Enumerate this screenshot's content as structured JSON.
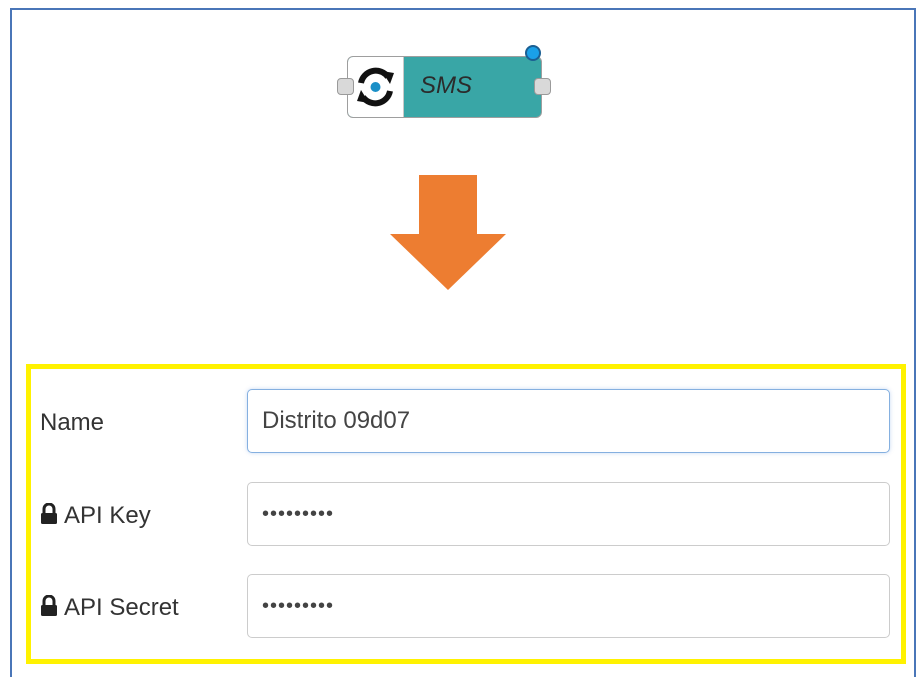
{
  "node": {
    "label": "SMS",
    "icon": "sync-icon",
    "colors": {
      "body": "#39a6a6",
      "status": "#1aa0e8"
    }
  },
  "arrow": {
    "color": "#ed7d31"
  },
  "highlight": {
    "color": "#fff200"
  },
  "form": {
    "name": {
      "label": "Name",
      "value": "Distrito 09d07"
    },
    "api_key": {
      "label": "API Key",
      "value": "•••••••••"
    },
    "api_secret": {
      "label": "API Secret",
      "value": "•••••••••"
    }
  }
}
